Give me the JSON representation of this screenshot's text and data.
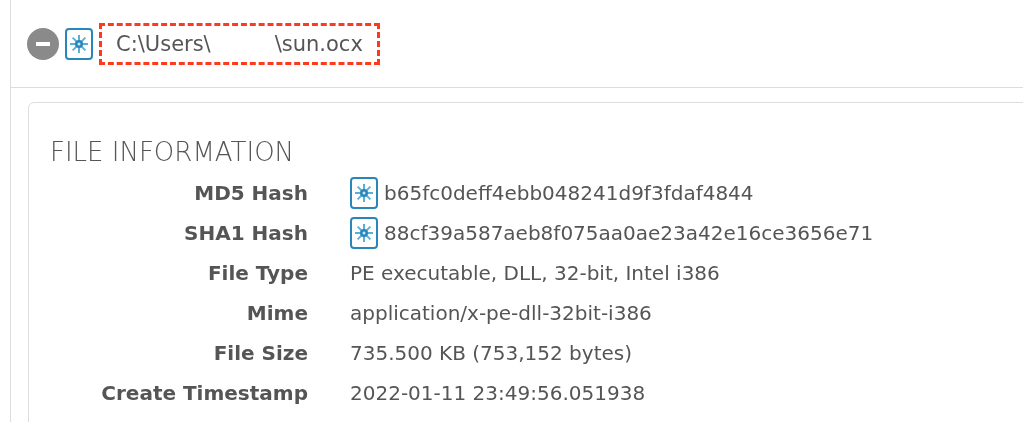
{
  "header": {
    "expanded": true,
    "highlighted": true,
    "path_parts": [
      "C:\\Users\\",
      "\\sun.ocx"
    ]
  },
  "section": {
    "title": "FILE INFORMATION",
    "rows": [
      {
        "label": "MD5 Hash",
        "value": "b65fc0deff4ebb048241d9f3fdaf4844",
        "kind": "hash"
      },
      {
        "label": "SHA1 Hash",
        "value": "88cf39a587aeb8f075aa0ae23a42e16ce3656e71",
        "kind": "hash"
      },
      {
        "label": "File Type",
        "value": "PE executable, DLL, 32-bit, Intel i386",
        "kind": "text"
      },
      {
        "label": "Mime",
        "value": "application/x-pe-dll-32bit-i386",
        "kind": "text"
      },
      {
        "label": "File Size",
        "value": "735.500 KB (753,152 bytes)",
        "kind": "text"
      },
      {
        "label": "Create Timestamp",
        "value": "2022-01-11 23:49:56.051938",
        "kind": "text"
      }
    ]
  }
}
